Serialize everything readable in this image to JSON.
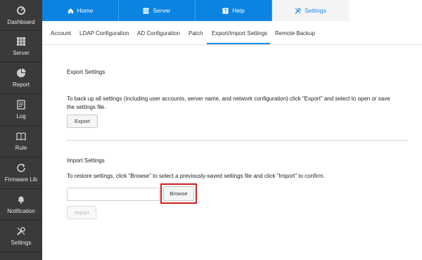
{
  "sidebar": {
    "items": [
      {
        "label": "Dashboard",
        "icon": "dashboard-icon"
      },
      {
        "label": "Server",
        "icon": "server-icon"
      },
      {
        "label": "Report",
        "icon": "pie-chart-icon"
      },
      {
        "label": "Log",
        "icon": "log-icon"
      },
      {
        "label": "Rule",
        "icon": "book-icon"
      },
      {
        "label": "Firmware Lib",
        "icon": "refresh-icon"
      },
      {
        "label": "Notification",
        "icon": "bell-icon"
      },
      {
        "label": "Settings",
        "icon": "wrench-icon"
      }
    ]
  },
  "topnav": {
    "tabs": [
      {
        "label": "Home",
        "icon": "home-icon"
      },
      {
        "label": "Server",
        "icon": "server-icon"
      },
      {
        "label": "Help",
        "icon": "help-icon"
      },
      {
        "label": "Settings",
        "icon": "wrench-icon",
        "active": true
      }
    ]
  },
  "subnav": {
    "items": [
      "Account",
      "LDAP Configuration",
      "AD Configuration",
      "Patch",
      "Export/Import Settings",
      "Remote Backup"
    ],
    "active": "Export/Import Settings"
  },
  "export": {
    "title": "Export Settings",
    "description": "To back up all settings (including user accounts, server name, and network configuration) click \"Export\" and select to open or save the settings file.",
    "button": "Export"
  },
  "import": {
    "title": "Import Settings",
    "description": "To restore settings, click \"Browse\" to select a previously-saved settings file and click \"Import\" to confirm.",
    "browse_button": "Browse",
    "import_button": "Import",
    "file_value": ""
  },
  "colors": {
    "accent": "#0a84e0",
    "sidebar_bg": "#3a3a3a",
    "highlight": "#d0201e"
  }
}
